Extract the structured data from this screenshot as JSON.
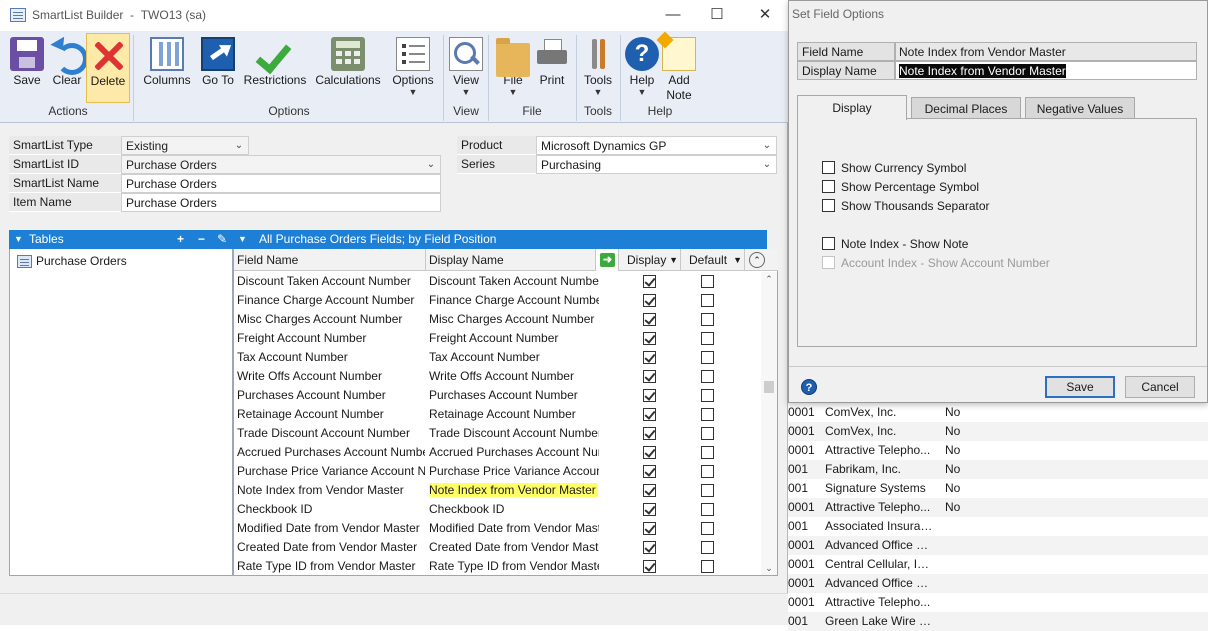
{
  "window": {
    "title": "SmartList Builder",
    "subtitle": "TWO13 (sa)"
  },
  "ribbon": {
    "buttons": [
      {
        "label": "Save",
        "icon": "save-icon"
      },
      {
        "label": "Clear",
        "icon": "undo-icon"
      },
      {
        "label": "Delete",
        "icon": "delete-icon"
      },
      {
        "label": "Columns",
        "icon": "columns-icon"
      },
      {
        "label": "Go To",
        "icon": "goto-icon"
      },
      {
        "label": "Restrictions",
        "icon": "checkmark-icon"
      },
      {
        "label": "Calculations",
        "icon": "calculator-icon"
      },
      {
        "label": "Options",
        "icon": "options-icon"
      },
      {
        "label": "View",
        "icon": "view-icon"
      },
      {
        "label": "File",
        "icon": "folder-icon"
      },
      {
        "label": "Print",
        "icon": "printer-icon"
      },
      {
        "label": "Tools",
        "icon": "tools-icon"
      },
      {
        "label": "Help",
        "icon": "help-icon"
      },
      {
        "label": "Add",
        "label2": "Note",
        "icon": "note-icon"
      }
    ],
    "groups": [
      "Actions",
      "Options",
      "View",
      "File",
      "Tools",
      "Help"
    ]
  },
  "header": {
    "smartlist_type": {
      "label": "SmartList Type",
      "value": "Existing"
    },
    "smartlist_id": {
      "label": "SmartList ID",
      "value": "Purchase Orders"
    },
    "smartlist_name": {
      "label": "SmartList Name",
      "value": "Purchase Orders"
    },
    "item_name": {
      "label": "Item Name",
      "value": "Purchase Orders"
    },
    "product": {
      "label": "Product",
      "value": "Microsoft Dynamics GP"
    },
    "series": {
      "label": "Series",
      "value": "Purchasing"
    }
  },
  "tables_panel": {
    "title": "Tables",
    "items": [
      "Purchase Orders"
    ]
  },
  "grid": {
    "title": "All Purchase Orders Fields; by Field Position",
    "columns": [
      "Field Name",
      "Display Name",
      "Display",
      "Default"
    ],
    "rows": [
      {
        "field": "Discount Taken Account Number",
        "display": "Discount Taken Account Number",
        "checked": true,
        "default": false
      },
      {
        "field": "Finance Charge Account Number",
        "display": "Finance Charge Account Number",
        "checked": true,
        "default": false
      },
      {
        "field": "Misc Charges Account Number",
        "display": "Misc Charges Account Number",
        "checked": true,
        "default": false
      },
      {
        "field": "Freight Account Number",
        "display": "Freight Account Number",
        "checked": true,
        "default": false
      },
      {
        "field": "Tax Account Number",
        "display": "Tax Account Number",
        "checked": true,
        "default": false
      },
      {
        "field": "Write Offs Account Number",
        "display": "Write Offs Account Number",
        "checked": true,
        "default": false
      },
      {
        "field": "Purchases Account Number",
        "display": "Purchases Account Number",
        "checked": true,
        "default": false
      },
      {
        "field": "Retainage Account Number",
        "display": "Retainage Account Number",
        "checked": true,
        "default": false
      },
      {
        "field": "Trade Discount Account Number",
        "display": "Trade Discount Account Number",
        "checked": true,
        "default": false
      },
      {
        "field": "Accrued Purchases Account Number",
        "display": "Accrued Purchases Account Number",
        "checked": true,
        "default": false
      },
      {
        "field": "Purchase Price Variance Account Number",
        "display": "Purchase Price Variance Account Number",
        "checked": true,
        "default": false
      },
      {
        "field": "Note Index from Vendor Master",
        "display": "Note Index from Vendor Master",
        "checked": true,
        "default": false,
        "highlight": true
      },
      {
        "field": "Checkbook ID",
        "display": "Checkbook ID",
        "checked": true,
        "default": false
      },
      {
        "field": "Modified Date from Vendor Master",
        "display": "Modified Date from Vendor Master",
        "checked": true,
        "default": false
      },
      {
        "field": "Created Date from Vendor Master",
        "display": "Created Date from Vendor Master",
        "checked": true,
        "default": false
      },
      {
        "field": "Rate Type ID from Vendor Master",
        "display": "Rate Type ID from Vendor Master",
        "checked": true,
        "default": false
      }
    ]
  },
  "background_list": [
    {
      "c1": "0001",
      "c2": "ComVex, Inc.",
      "c3": "No"
    },
    {
      "c1": "0001",
      "c2": "ComVex, Inc.",
      "c3": "No"
    },
    {
      "c1": "0001",
      "c2": "Attractive Telepho...",
      "c3": "No"
    },
    {
      "c1": "001",
      "c2": "Fabrikam, Inc.",
      "c3": "No"
    },
    {
      "c1": "001",
      "c2": "Signature Systems",
      "c3": "No"
    },
    {
      "c1": "0001",
      "c2": "Attractive Telepho...",
      "c3": "No"
    },
    {
      "c1": "001",
      "c2": "Associated Insuran...",
      "c3": ""
    },
    {
      "c1": "0001",
      "c2": "Advanced Office S...",
      "c3": ""
    },
    {
      "c1": "0001",
      "c2": "Central Cellular, Inc.",
      "c3": ""
    },
    {
      "c1": "0001",
      "c2": "Advanced Office S...",
      "c3": ""
    },
    {
      "c1": "0001",
      "c2": "Attractive Telepho...",
      "c3": ""
    },
    {
      "c1": "001",
      "c2": "Green Lake Wire C...",
      "c3": ""
    }
  ],
  "dialog": {
    "title": "Set Field Options",
    "field_name": {
      "label": "Field Name",
      "value": "Note Index from Vendor Master"
    },
    "display_name": {
      "label": "Display Name",
      "value": "Note Index from Vendor Master"
    },
    "tabs": [
      "Display",
      "Decimal Places",
      "Negative Values"
    ],
    "options": [
      {
        "label": "Show Currency Symbol",
        "checked": false,
        "enabled": true
      },
      {
        "label": "Show Percentage Symbol",
        "checked": false,
        "enabled": true
      },
      {
        "label": "Show Thousands Separator",
        "checked": false,
        "enabled": true
      },
      {
        "label": "Note Index - Show Note",
        "checked": false,
        "enabled": true
      },
      {
        "label": "Account Index - Show Account Number",
        "checked": false,
        "enabled": false
      }
    ],
    "save_label": "Save",
    "cancel_label": "Cancel"
  },
  "colors": {
    "accent": "#1e7fd6",
    "highlight": "#ffff66",
    "active_button": "#fde9a8"
  }
}
